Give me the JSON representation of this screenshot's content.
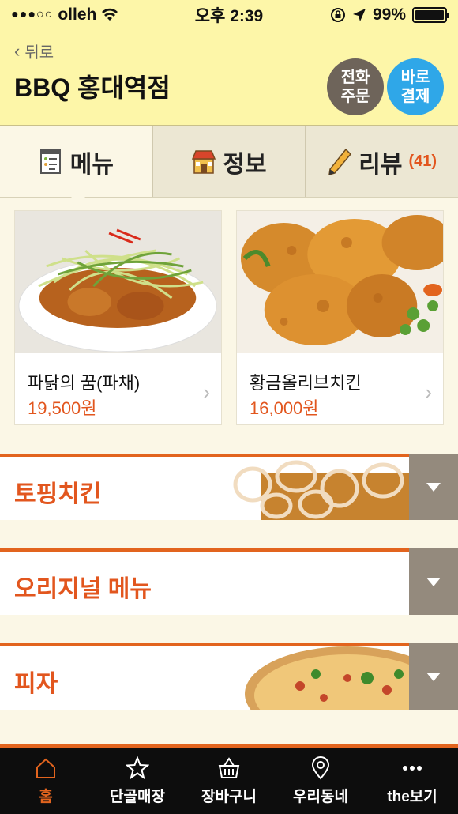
{
  "status": {
    "carrier": "olleh",
    "time": "오후 2:39",
    "battery": "99%"
  },
  "header": {
    "back_label": "뒤로",
    "title": "BBQ 홍대역점",
    "phone_order": [
      "전화",
      "주문"
    ],
    "direct_pay": [
      "바로",
      "결제"
    ]
  },
  "tabs": [
    {
      "label": "메뉴",
      "icon": "menu-doc-icon"
    },
    {
      "label": "정보",
      "icon": "store-icon"
    },
    {
      "label": "리뷰",
      "icon": "pencil-icon",
      "count": "(41)"
    }
  ],
  "products": [
    {
      "name": "파닭의 꿈(파채)",
      "price": "19,500원"
    },
    {
      "name": "황금올리브치킨",
      "price": "16,000원"
    }
  ],
  "categories": [
    {
      "label": "토핑치킨"
    },
    {
      "label": "오리지널 메뉴"
    },
    {
      "label": "피자"
    }
  ],
  "nav": [
    {
      "label": "홈",
      "icon": "home-icon"
    },
    {
      "label": "단골매장",
      "icon": "star-icon"
    },
    {
      "label": "장바구니",
      "icon": "basket-icon"
    },
    {
      "label": "우리동네",
      "icon": "location-pin-icon"
    },
    {
      "label": "the보기",
      "icon": "more-dots-icon"
    }
  ],
  "colors": {
    "accent": "#e2561e",
    "header_bg": "#fdf6a8",
    "phone_btn": "#6e645a",
    "pay_btn": "#2fa7e8"
  }
}
